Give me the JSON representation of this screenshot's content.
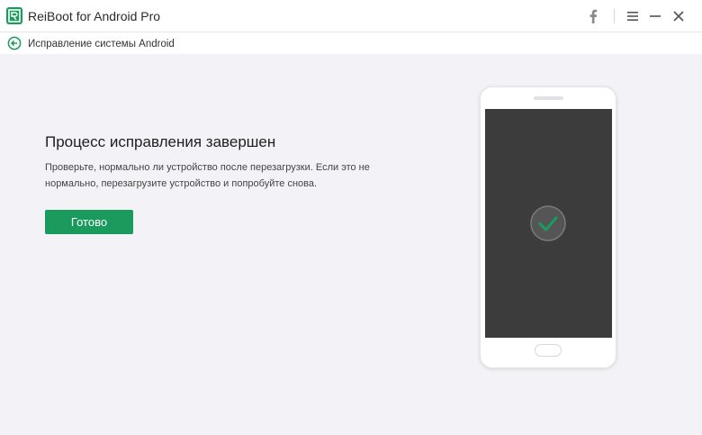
{
  "titlebar": {
    "app_title": "ReiBoot for Android Pro",
    "icons": [
      "facebook-icon",
      "menu-icon",
      "minimize-icon",
      "close-icon"
    ]
  },
  "nav": {
    "breadcrumb": "Исправление системы Android"
  },
  "main": {
    "heading": "Процесс исправления завершен",
    "description": "Проверьте, нормально ли устройство после перезагрузки. Если это не нормально, перезагрузите устройство и попробуйте снова.",
    "done_button": "Готово"
  },
  "colors": {
    "brand_green": "#1a9a5c",
    "background": "#f3f3f7",
    "phone_screen": "#3c3c3c"
  }
}
